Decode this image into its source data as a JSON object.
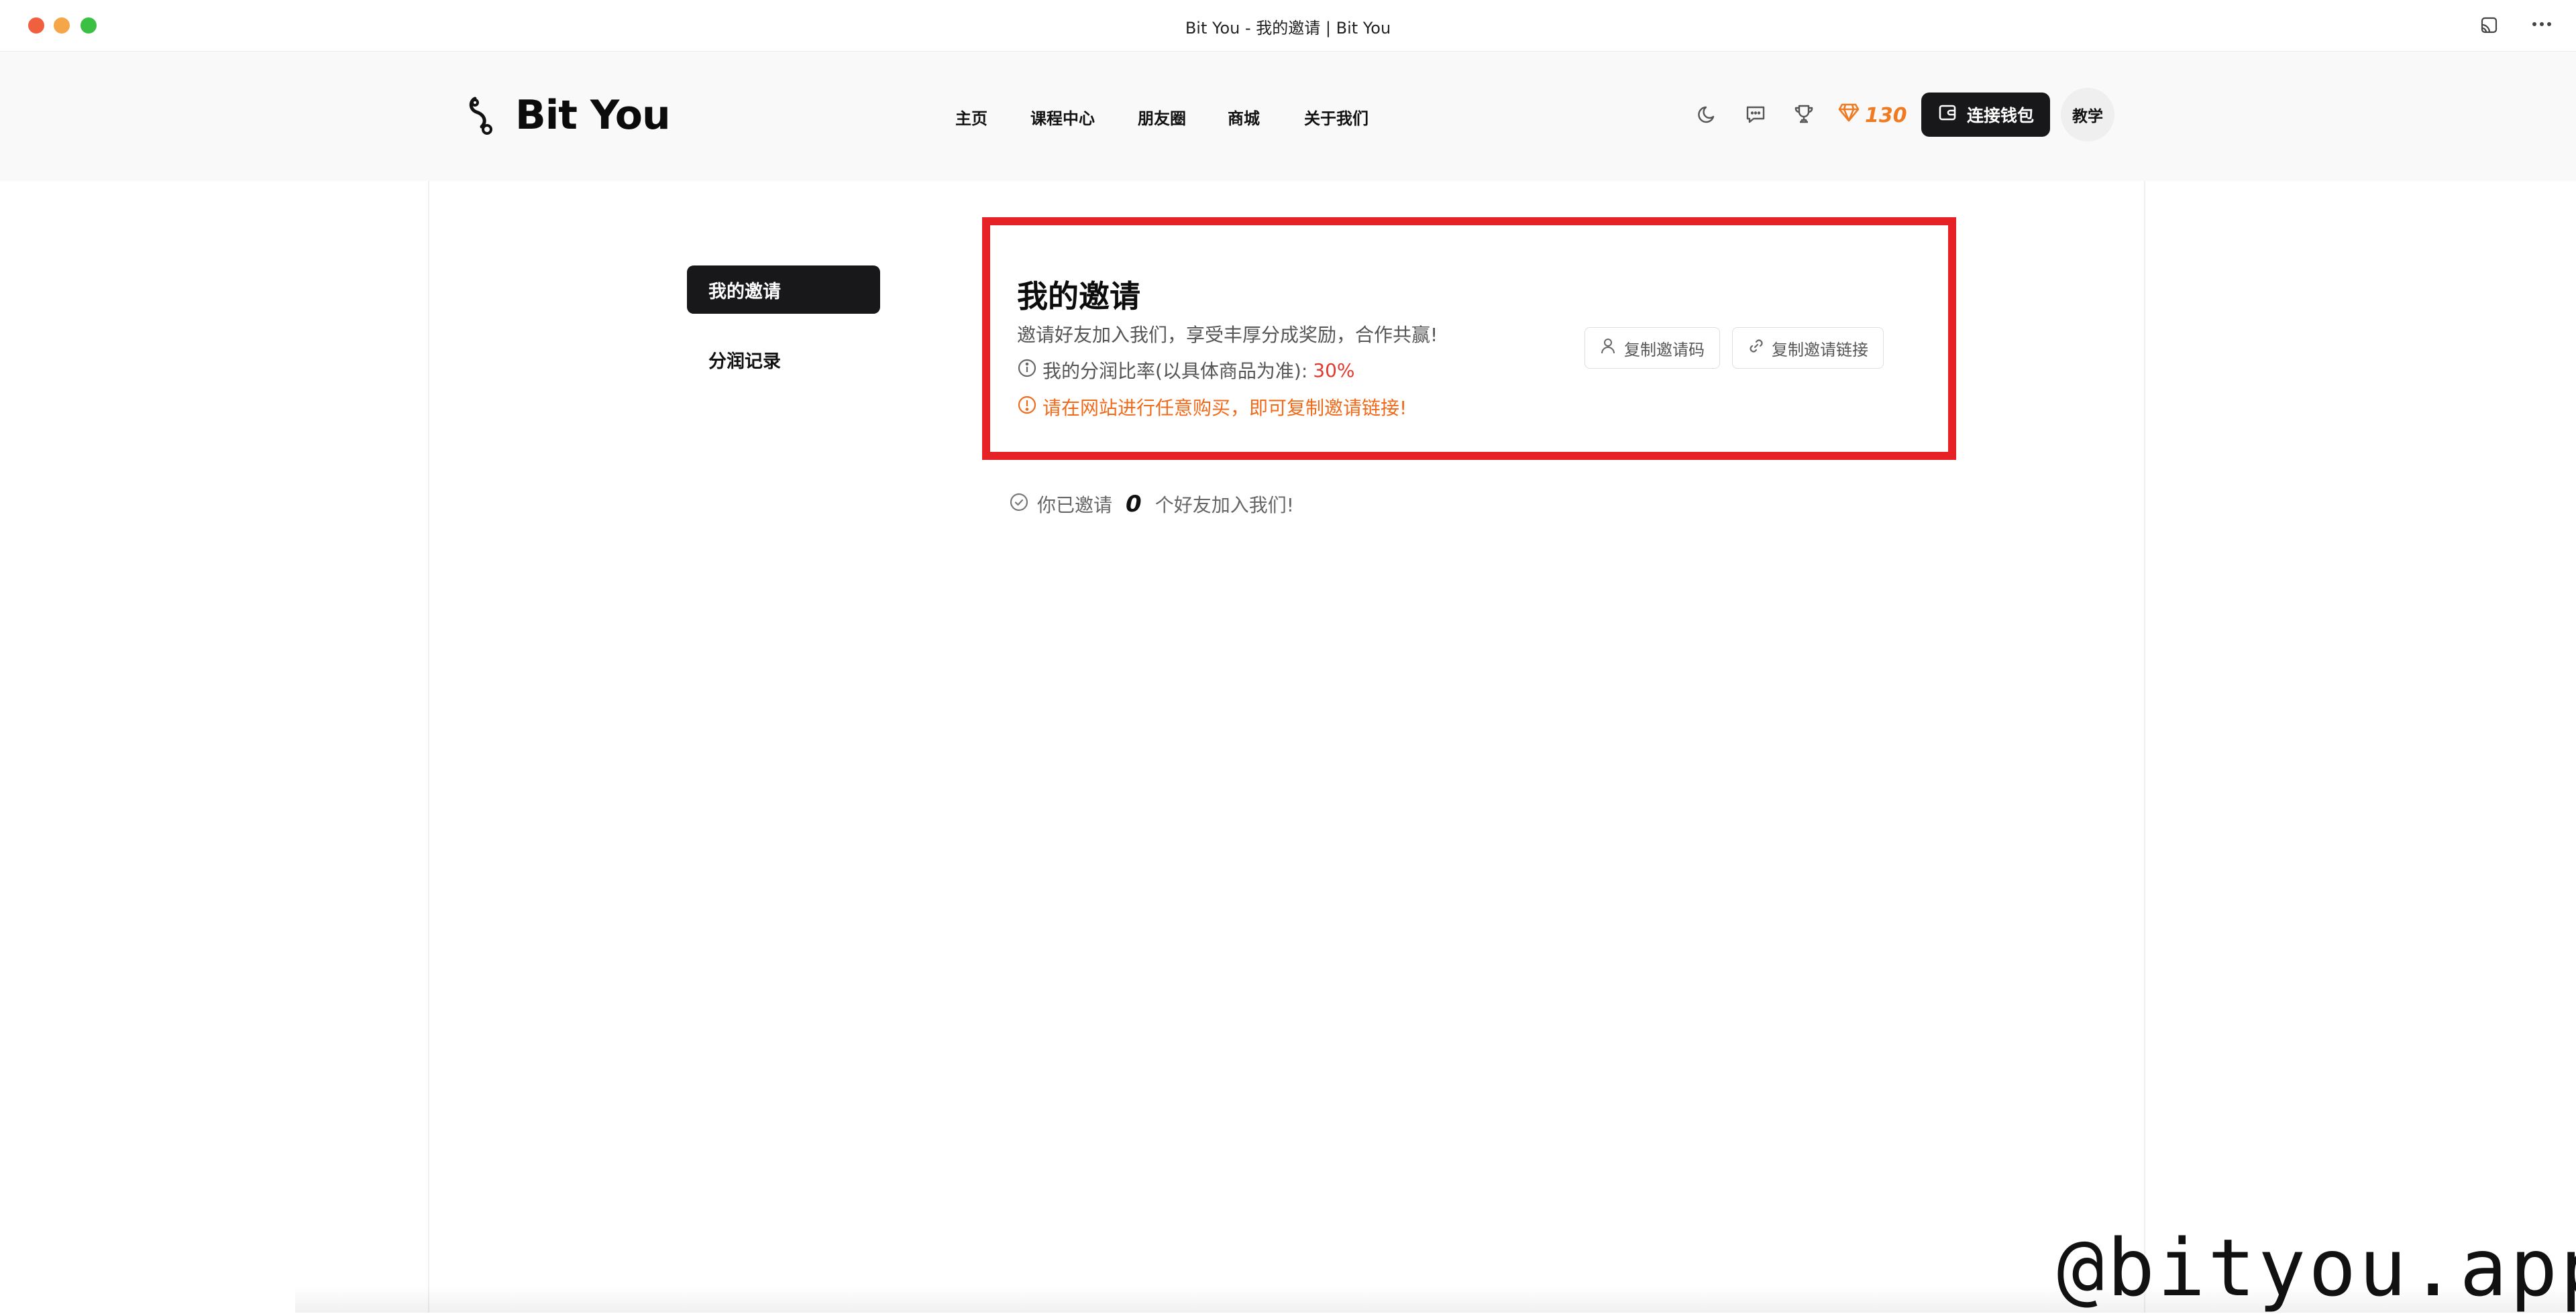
{
  "window": {
    "title": "Bit You - 我的邀请 | Bit You"
  },
  "header": {
    "logo_text": "Bit You",
    "nav": [
      "主页",
      "课程中心",
      "朋友圈",
      "商城",
      "关于我们"
    ],
    "points": "130",
    "connect_wallet": "连接钱包",
    "teach": "教学"
  },
  "sidebar": {
    "items": [
      {
        "label": "我的邀请",
        "active": true
      },
      {
        "label": "分润记录",
        "active": false
      }
    ]
  },
  "invite": {
    "title": "我的邀请",
    "description": "邀请好友加入我们，享受丰厚分成奖励，合作共赢!",
    "rate_label": "我的分润比率(以具体商品为准):",
    "rate_value": "30%",
    "warning": "请在网站进行任意购买，即可复制邀请链接!",
    "copy_code": "复制邀请码",
    "copy_link": "复制邀请链接"
  },
  "invited": {
    "prefix": "你已邀请",
    "count": "0",
    "suffix": "个好友加入我们!"
  },
  "watermark": "@bityou.app",
  "colors": {
    "accent_orange": "#f06a1a",
    "rate_red": "#e03a2f",
    "highlight_border": "#e62226",
    "primary_dark": "#18181b"
  },
  "icons": {
    "titlebar": [
      "screen-mirror-icon",
      "more-icon"
    ],
    "header": [
      "moon-icon",
      "message-icon",
      "trophy-icon",
      "diamond-icon",
      "wallet-icon"
    ]
  }
}
